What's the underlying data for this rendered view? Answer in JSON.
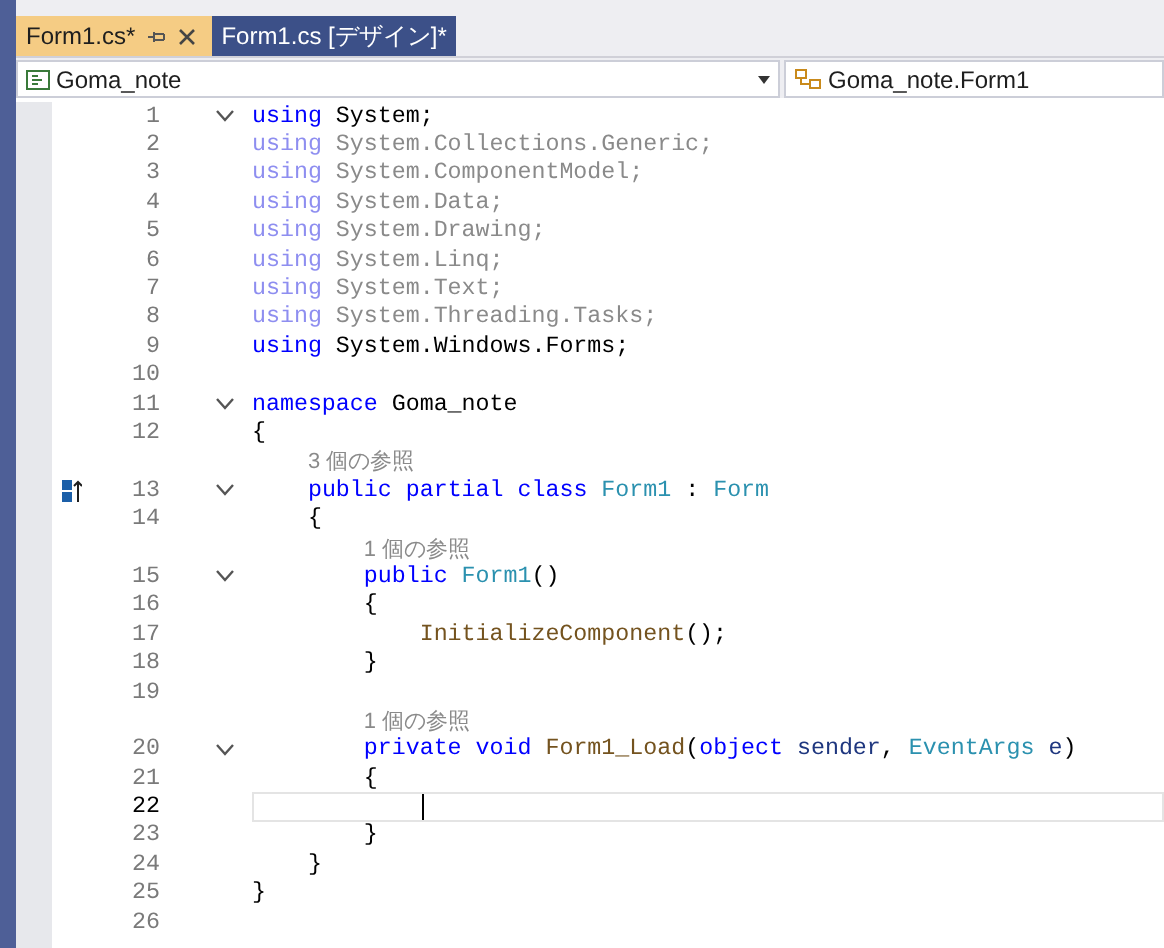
{
  "tabs": [
    {
      "label": "Form1.cs*",
      "selected": true,
      "pinnable": true,
      "closable": true
    },
    {
      "label": "Form1.cs [デザイン]*",
      "selected": false
    }
  ],
  "navigation": {
    "project": "Goma_note",
    "type": "Goma_note.Form1"
  },
  "editor": {
    "rows": [
      {
        "kind": "code",
        "number": "1",
        "expanded": true,
        "tokens": [
          {
            "text": "using",
            "kind": "keyword"
          },
          {
            "text": " System;",
            "kind": "plain"
          }
        ]
      },
      {
        "kind": "code",
        "number": "2",
        "tokens": [
          {
            "text": "using",
            "kind": "unused_keyword"
          },
          {
            "text": " System.Collections.Generic;",
            "kind": "unused"
          }
        ]
      },
      {
        "kind": "code",
        "number": "3",
        "tokens": [
          {
            "text": "using",
            "kind": "unused_keyword"
          },
          {
            "text": " System.ComponentModel;",
            "kind": "unused"
          }
        ]
      },
      {
        "kind": "code",
        "number": "4",
        "tokens": [
          {
            "text": "using",
            "kind": "unused_keyword"
          },
          {
            "text": " System.Data;",
            "kind": "unused"
          }
        ]
      },
      {
        "kind": "code",
        "number": "5",
        "tokens": [
          {
            "text": "using",
            "kind": "unused_keyword"
          },
          {
            "text": " System.Drawing;",
            "kind": "unused"
          }
        ]
      },
      {
        "kind": "code",
        "number": "6",
        "tokens": [
          {
            "text": "using",
            "kind": "unused_keyword"
          },
          {
            "text": " System.Linq;",
            "kind": "unused"
          }
        ]
      },
      {
        "kind": "code",
        "number": "7",
        "tokens": [
          {
            "text": "using",
            "kind": "unused_keyword"
          },
          {
            "text": " System.Text;",
            "kind": "unused"
          }
        ]
      },
      {
        "kind": "code",
        "number": "8",
        "tokens": [
          {
            "text": "using",
            "kind": "unused_keyword"
          },
          {
            "text": " System.Threading.Tasks;",
            "kind": "unused"
          }
        ]
      },
      {
        "kind": "code",
        "number": "9",
        "tokens": [
          {
            "text": "using",
            "kind": "keyword"
          },
          {
            "text": " System.Windows.Forms;",
            "kind": "plain"
          }
        ]
      },
      {
        "kind": "code",
        "number": "10"
      },
      {
        "kind": "code",
        "number": "11",
        "expanded": true,
        "tokens": [
          {
            "text": "namespace",
            "kind": "keyword"
          },
          {
            "text": " Goma_note",
            "kind": "plain"
          }
        ]
      },
      {
        "kind": "code",
        "number": "12",
        "tokens": [
          {
            "text": "{",
            "kind": "plain"
          }
        ]
      },
      {
        "kind": "codelens",
        "indent": "    ",
        "text": "3 個の参照"
      },
      {
        "kind": "code",
        "number": "13",
        "expanded": true,
        "has_base_marker": true,
        "tokens": [
          {
            "text": "    public",
            "kind": "keyword"
          },
          {
            "text": " partial",
            "kind": "keyword"
          },
          {
            "text": " class",
            "kind": "keyword"
          },
          {
            "text": " Form1",
            "kind": "type"
          },
          {
            "text": " : ",
            "kind": "plain"
          },
          {
            "text": "Form",
            "kind": "type"
          }
        ]
      },
      {
        "kind": "code",
        "number": "14",
        "tokens": [
          {
            "text": "    {",
            "kind": "plain"
          }
        ]
      },
      {
        "kind": "codelens",
        "indent": "        ",
        "text": "1 個の参照"
      },
      {
        "kind": "code",
        "number": "15",
        "expanded": true,
        "tokens": [
          {
            "text": "        public",
            "kind": "keyword"
          },
          {
            "text": " Form1",
            "kind": "type"
          },
          {
            "text": "()",
            "kind": "plain"
          }
        ]
      },
      {
        "kind": "code",
        "number": "16",
        "tokens": [
          {
            "text": "        {",
            "kind": "plain"
          }
        ]
      },
      {
        "kind": "code",
        "number": "17",
        "tokens": [
          {
            "text": "            InitializeComponent",
            "kind": "method"
          },
          {
            "text": "();",
            "kind": "plain"
          }
        ]
      },
      {
        "kind": "code",
        "number": "18",
        "tokens": [
          {
            "text": "        }",
            "kind": "plain"
          }
        ]
      },
      {
        "kind": "code",
        "number": "19"
      },
      {
        "kind": "codelens",
        "indent": "        ",
        "text": "1 個の参照"
      },
      {
        "kind": "code",
        "number": "20",
        "expanded": true,
        "tokens": [
          {
            "text": "        private",
            "kind": "keyword"
          },
          {
            "text": " void",
            "kind": "keyword"
          },
          {
            "text": " Form1_Load",
            "kind": "method"
          },
          {
            "text": "(",
            "kind": "plain"
          },
          {
            "text": "object",
            "kind": "keyword"
          },
          {
            "text": " sender",
            "kind": "parameter"
          },
          {
            "text": ", ",
            "kind": "plain"
          },
          {
            "text": "EventArgs",
            "kind": "type"
          },
          {
            "text": " e",
            "kind": "parameter"
          },
          {
            "text": ")",
            "kind": "plain"
          }
        ]
      },
      {
        "kind": "code",
        "number": "21",
        "tokens": [
          {
            "text": "        {",
            "kind": "plain"
          }
        ]
      },
      {
        "kind": "code",
        "number": "22",
        "current": true,
        "caret_indent": "            "
      },
      {
        "kind": "code",
        "number": "23",
        "tokens": [
          {
            "text": "        }",
            "kind": "plain"
          }
        ]
      },
      {
        "kind": "code",
        "number": "24",
        "tokens": [
          {
            "text": "    }",
            "kind": "plain"
          }
        ]
      },
      {
        "kind": "code",
        "number": "25",
        "tokens": [
          {
            "text": "}",
            "kind": "plain"
          }
        ]
      },
      {
        "kind": "code",
        "number": "26"
      }
    ]
  }
}
